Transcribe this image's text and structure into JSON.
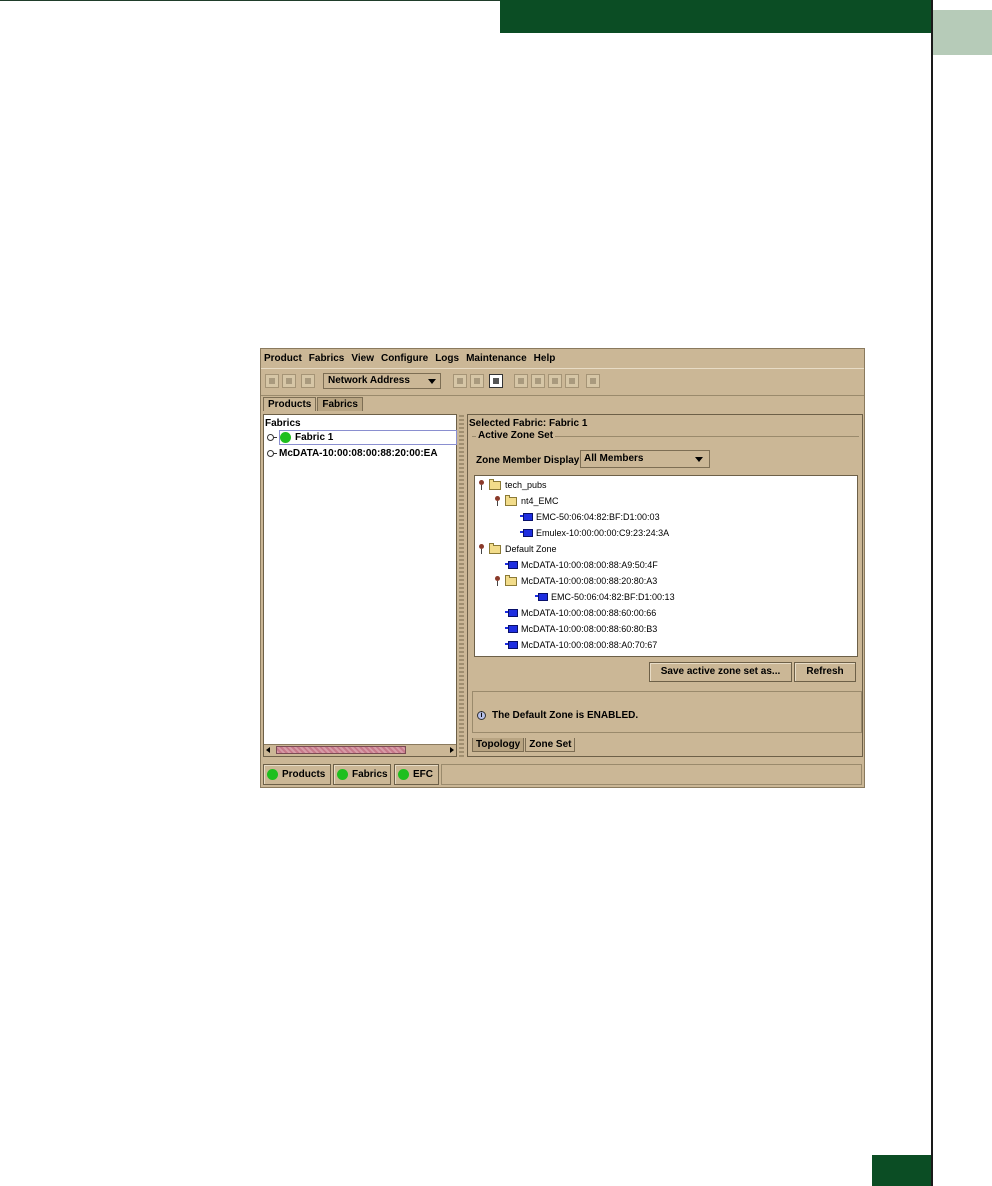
{
  "menubar": {
    "items": [
      "Product",
      "Fabrics",
      "View",
      "Configure",
      "Logs",
      "Maintenance",
      "Help"
    ]
  },
  "toolbar": {
    "address_combo": "Network Address"
  },
  "top_tabs": [
    "Products",
    "Fabrics"
  ],
  "fabrics_pane": {
    "title": "Fabrics",
    "items": [
      "Fabric 1",
      "McDATA-10:00:08:00:88:20:00:EA"
    ]
  },
  "right_pane": {
    "selected_fabric": "Selected Fabric: Fabric 1",
    "group_title": "Active Zone Set",
    "zone_member_display_label": "Zone Member Display",
    "zone_member_display_value": "All Members",
    "tree": [
      "tech_pubs",
      "nt4_EMC",
      "EMC-50:06:04:82:BF:D1:00:03",
      "Emulex-10:00:00:00:C9:23:24:3A",
      "Default Zone",
      "McDATA-10:00:08:00:88:A9:50:4F",
      "McDATA-10:00:08:00:88:20:80:A3",
      "EMC-50:06:04:82:BF:D1:00:13",
      "McDATA-10:00:08:00:88:60:00:66",
      "McDATA-10:00:08:00:88:60:80:B3",
      "McDATA-10:00:08:00:88:A0:70:67"
    ],
    "save_button": "Save active zone set as...",
    "refresh_button": "Refresh",
    "status_message": "The Default Zone is ENABLED.",
    "bottom_tabs": [
      "Topology",
      "Zone Set"
    ]
  },
  "bottom_bar": [
    "Products",
    "Fabrics",
    "EFC"
  ],
  "colors": {
    "band_green": "#0b4d24",
    "corner_tab": "#b6cbb8",
    "window_bg": "#cbb796",
    "status_green": "#1fbf1f",
    "device_blue": "#1e2ee0"
  }
}
